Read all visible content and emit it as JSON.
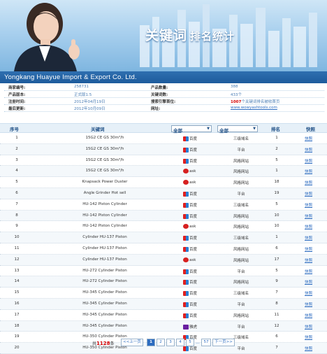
{
  "banner": {
    "title": "关键词",
    "title2": "排名统计"
  },
  "company": "Yongkang Huayue Import & Export Co. Ltd.",
  "info": [
    {
      "l1": "商家编号:",
      "v1": "258731",
      "l2": "产品数量:",
      "v2": "388"
    },
    {
      "l1": "产品版本:",
      "v1": "正式版1.5",
      "l2": "关键词数:",
      "v2": "433个"
    },
    {
      "l1": "注册时间:",
      "v1": "2012年04月19日",
      "l2": "搜索引擎首位:",
      "v2_red": "1007",
      "v2": "个关键词排名被收首页"
    },
    {
      "l1": "最后更新:",
      "v1": "2012年10月09日",
      "l2": "网址:",
      "v2_link": "www.wowyashtools.com"
    }
  ],
  "table": {
    "col_num": "序号",
    "col_kw": "关键词",
    "filter_engine": "全部",
    "filter_platform": "全部",
    "col_rank": "排名",
    "col_action": "快照"
  },
  "rows": [
    {
      "num": "1",
      "kw": "15G2 CE GS 30m³/h",
      "engine": "baidu",
      "engine_label": "百度",
      "plat": "三级域名",
      "rank": "1",
      "act": "快照"
    },
    {
      "num": "2",
      "kw": "15G2 CE GS 30m³/h",
      "engine": "baidu",
      "engine_label": "百度",
      "plat": "平台",
      "rank": "2",
      "act": "快照"
    },
    {
      "num": "3",
      "kw": "15G2 CE GS 30m³/h",
      "engine": "baidu",
      "engine_label": "百度",
      "plat": "风格网站",
      "rank": "5",
      "act": "快照"
    },
    {
      "num": "4",
      "kw": "15G2 CE GS 30m³/h",
      "engine": "ask",
      "engine_label": "ask",
      "plat": "风格网站",
      "rank": "1",
      "act": "快照"
    },
    {
      "num": "5",
      "kw": "Knapsack Power Duster",
      "engine": "ask",
      "engine_label": "ask",
      "plat": "风格网站",
      "rank": "18",
      "act": "快照"
    },
    {
      "num": "6",
      "kw": "Angle Grinder Hot sell",
      "engine": "baidu",
      "engine_label": "百度",
      "plat": "平台",
      "rank": "19",
      "act": "快照"
    },
    {
      "num": "7",
      "kw": "HU-142 Piston Cylinder",
      "engine": "baidu",
      "engine_label": "百度",
      "plat": "三级域名",
      "rank": "5",
      "act": "快照"
    },
    {
      "num": "8",
      "kw": "HU-142 Piston Cylinder",
      "engine": "baidu",
      "engine_label": "百度",
      "plat": "风格网站",
      "rank": "10",
      "act": "快照"
    },
    {
      "num": "9",
      "kw": "HU-142 Piston Cylinder",
      "engine": "ask",
      "engine_label": "ask",
      "plat": "风格网站",
      "rank": "10",
      "act": "快照"
    },
    {
      "num": "10",
      "kw": "Cylinder HU-137 Piston",
      "engine": "baidu",
      "engine_label": "百度",
      "plat": "三级域名",
      "rank": "1",
      "act": "快照"
    },
    {
      "num": "11",
      "kw": "Cylinder HU-137 Piston",
      "engine": "baidu",
      "engine_label": "百度",
      "plat": "风格网站",
      "rank": "6",
      "act": "快照"
    },
    {
      "num": "12",
      "kw": "Cylinder HU-137 Piston",
      "engine": "ask",
      "engine_label": "ask",
      "plat": "风格网站",
      "rank": "17",
      "act": "快照"
    },
    {
      "num": "13",
      "kw": "HU-272 Cylinder Piston",
      "engine": "baidu",
      "engine_label": "百度",
      "plat": "平台",
      "rank": "5",
      "act": "快照"
    },
    {
      "num": "14",
      "kw": "HU-272 Cylinder Piston",
      "engine": "baidu",
      "engine_label": "百度",
      "plat": "风格网站",
      "rank": "9",
      "act": "快照"
    },
    {
      "num": "15",
      "kw": "HU-345 Cylinder Piston",
      "engine": "baidu",
      "engine_label": "百度",
      "plat": "三级域名",
      "rank": "7",
      "act": "快照"
    },
    {
      "num": "16",
      "kw": "HU-345 Cylinder Piston",
      "engine": "baidu",
      "engine_label": "百度",
      "plat": "平台",
      "rank": "8",
      "act": "快照"
    },
    {
      "num": "17",
      "kw": "HU-345 Cylinder Piston",
      "engine": "baidu",
      "engine_label": "百度",
      "plat": "风格网站",
      "rank": "11",
      "act": "快照"
    },
    {
      "num": "18",
      "kw": "HU-345 Cylinder Piston",
      "engine": "yahoo",
      "engine_label": "雅虎",
      "plat": "平台",
      "rank": "12",
      "act": "快照"
    },
    {
      "num": "19",
      "kw": "HU-350 Cylinder Piston",
      "engine": "baidu",
      "engine_label": "百度",
      "plat": "三级域名",
      "rank": "6",
      "act": "快照"
    },
    {
      "num": "20",
      "kw": "HU-350 Cylinder Piston",
      "engine": "baidu",
      "engine_label": "百度",
      "plat": "平台",
      "rank": "7",
      "act": "快照"
    }
  ],
  "pager": {
    "total_prefix": "共",
    "total": "1128",
    "total_suffix": "条",
    "prev": "<<上一页",
    "pages": [
      "1",
      "2",
      "3",
      "4",
      "5",
      "...",
      "57"
    ],
    "next": "下一页>>"
  }
}
